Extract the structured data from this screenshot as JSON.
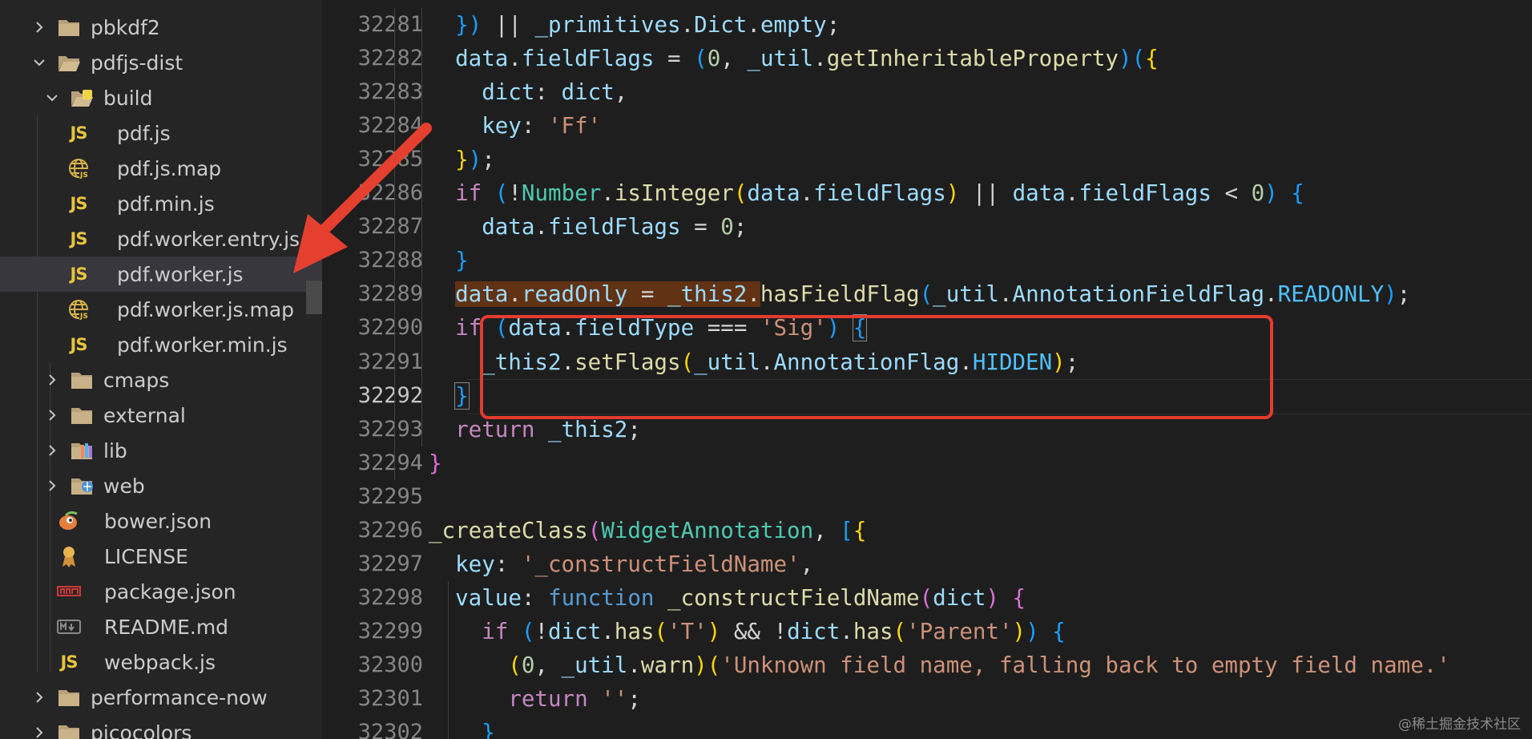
{
  "explorer": {
    "items": [
      {
        "label": "pbkdf2",
        "kind": "folder",
        "expanded": false,
        "indent": 0,
        "icon": "folder-icon"
      },
      {
        "label": "pdfjs-dist",
        "kind": "folder",
        "expanded": true,
        "indent": 0,
        "icon": "folder-open-icon"
      },
      {
        "label": "build",
        "kind": "folder",
        "expanded": true,
        "indent": 1,
        "icon": "folder-build-icon"
      },
      {
        "label": "pdf.js",
        "kind": "file",
        "indent": 2,
        "icon": "js-icon"
      },
      {
        "label": "pdf.js.map",
        "kind": "file",
        "indent": 2,
        "icon": "globe-map-icon"
      },
      {
        "label": "pdf.min.js",
        "kind": "file",
        "indent": 2,
        "icon": "js-icon"
      },
      {
        "label": "pdf.worker.entry.js",
        "kind": "file",
        "indent": 2,
        "icon": "js-icon"
      },
      {
        "label": "pdf.worker.js",
        "kind": "file",
        "indent": 2,
        "icon": "js-icon",
        "selected": true
      },
      {
        "label": "pdf.worker.js.map",
        "kind": "file",
        "indent": 2,
        "icon": "globe-map-icon"
      },
      {
        "label": "pdf.worker.min.js",
        "kind": "file",
        "indent": 2,
        "icon": "js-icon"
      },
      {
        "label": "cmaps",
        "kind": "folder",
        "expanded": false,
        "indent": 1,
        "icon": "folder-icon"
      },
      {
        "label": "external",
        "kind": "folder",
        "expanded": false,
        "indent": 1,
        "icon": "folder-icon"
      },
      {
        "label": "lib",
        "kind": "folder",
        "expanded": false,
        "indent": 1,
        "icon": "folder-lib-icon"
      },
      {
        "label": "web",
        "kind": "folder",
        "expanded": false,
        "indent": 1,
        "icon": "folder-web-icon"
      },
      {
        "label": "bower.json",
        "kind": "file",
        "indent": 1,
        "icon": "bower-icon"
      },
      {
        "label": "LICENSE",
        "kind": "file",
        "indent": 1,
        "icon": "license-icon"
      },
      {
        "label": "package.json",
        "kind": "file",
        "indent": 1,
        "icon": "npm-icon"
      },
      {
        "label": "README.md",
        "kind": "file",
        "indent": 1,
        "icon": "markdown-icon"
      },
      {
        "label": "webpack.js",
        "kind": "file",
        "indent": 1,
        "icon": "js-icon"
      },
      {
        "label": "performance-now",
        "kind": "folder",
        "expanded": false,
        "indent": 0,
        "icon": "folder-icon"
      },
      {
        "label": "picocolors",
        "kind": "folder",
        "expanded": false,
        "indent": 0,
        "icon": "folder-icon"
      }
    ],
    "js_badge": "JS"
  },
  "editor": {
    "active_line": "32292",
    "lines": [
      {
        "num": "32281",
        "indent": 2,
        "tokens": [
          [
            "b3",
            "})"
          ],
          [
            "p",
            " || "
          ],
          [
            "v",
            "_primitives"
          ],
          [
            "p",
            "."
          ],
          [
            "v",
            "Dict"
          ],
          [
            "p",
            "."
          ],
          [
            "v",
            "empty"
          ],
          [
            "p",
            ";"
          ]
        ]
      },
      {
        "num": "32282",
        "indent": 2,
        "tokens": [
          [
            "v",
            "data"
          ],
          [
            "p",
            "."
          ],
          [
            "v",
            "fieldFlags"
          ],
          [
            "p",
            " = "
          ],
          [
            "b3",
            "("
          ],
          [
            "n",
            "0"
          ],
          [
            "p",
            ", "
          ],
          [
            "v",
            "_util"
          ],
          [
            "p",
            "."
          ],
          [
            "f",
            "getInheritableProperty"
          ],
          [
            "b3",
            ")"
          ],
          [
            "b3",
            "("
          ],
          [
            "b1",
            "{"
          ]
        ]
      },
      {
        "num": "32283",
        "indent": 3,
        "tokens": [
          [
            "v",
            "dict"
          ],
          [
            "p",
            ": "
          ],
          [
            "v",
            "dict"
          ],
          [
            "p",
            ","
          ]
        ]
      },
      {
        "num": "32284",
        "indent": 3,
        "tokens": [
          [
            "v",
            "key"
          ],
          [
            "p",
            ": "
          ],
          [
            "s",
            "'Ff'"
          ]
        ]
      },
      {
        "num": "32285",
        "indent": 2,
        "tokens": [
          [
            "b1",
            "}"
          ],
          [
            "b3",
            ")"
          ],
          [
            "p",
            ";"
          ]
        ]
      },
      {
        "num": "32286",
        "indent": 2,
        "tokens": [
          [
            "k",
            "if"
          ],
          [
            "p",
            " "
          ],
          [
            "b3",
            "("
          ],
          [
            "p",
            "!"
          ],
          [
            "c",
            "Number"
          ],
          [
            "p",
            "."
          ],
          [
            "f",
            "isInteger"
          ],
          [
            "b1",
            "("
          ],
          [
            "v",
            "data"
          ],
          [
            "p",
            "."
          ],
          [
            "v",
            "fieldFlags"
          ],
          [
            "b1",
            ")"
          ],
          [
            "p",
            " || "
          ],
          [
            "v",
            "data"
          ],
          [
            "p",
            "."
          ],
          [
            "v",
            "fieldFlags"
          ],
          [
            "p",
            " < "
          ],
          [
            "n",
            "0"
          ],
          [
            "b3",
            ")"
          ],
          [
            "p",
            " "
          ],
          [
            "b3",
            "{"
          ]
        ]
      },
      {
        "num": "32287",
        "indent": 3,
        "tokens": [
          [
            "v",
            "data"
          ],
          [
            "p",
            "."
          ],
          [
            "v",
            "fieldFlags"
          ],
          [
            "p",
            " = "
          ],
          [
            "n",
            "0"
          ],
          [
            "p",
            ";"
          ]
        ]
      },
      {
        "num": "32288",
        "indent": 2,
        "tokens": [
          [
            "b3",
            "}"
          ]
        ]
      },
      {
        "num": "32289",
        "indent": 2,
        "tokens": [
          [
            "vh",
            "data"
          ],
          [
            "ph",
            "."
          ],
          [
            "vh",
            "readOnly"
          ],
          [
            "ph",
            " = "
          ],
          [
            "vh",
            "_this2"
          ],
          [
            "ph",
            "."
          ],
          [
            "f",
            "hasFieldFlag"
          ],
          [
            "b3",
            "("
          ],
          [
            "v",
            "_util"
          ],
          [
            "p",
            "."
          ],
          [
            "v",
            "AnnotationFieldFlag"
          ],
          [
            "p",
            "."
          ],
          [
            "o",
            "READONLY"
          ],
          [
            "b3",
            ")"
          ],
          [
            "p",
            ";"
          ]
        ]
      },
      {
        "num": "32290",
        "indent": 2,
        "tokens": [
          [
            "k",
            "if"
          ],
          [
            "p",
            " "
          ],
          [
            "b3",
            "("
          ],
          [
            "v",
            "data"
          ],
          [
            "p",
            "."
          ],
          [
            "v",
            "fieldType"
          ],
          [
            "p",
            " === "
          ],
          [
            "s",
            "'Sig'"
          ],
          [
            "b3",
            ")"
          ],
          [
            "p",
            " "
          ],
          [
            "bx",
            "{"
          ]
        ]
      },
      {
        "num": "32291",
        "indent": 3,
        "tokens": [
          [
            "v",
            "_this2"
          ],
          [
            "p",
            "."
          ],
          [
            "f",
            "setFlags"
          ],
          [
            "b1",
            "("
          ],
          [
            "v",
            "_util"
          ],
          [
            "p",
            "."
          ],
          [
            "v",
            "AnnotationFlag"
          ],
          [
            "p",
            "."
          ],
          [
            "o",
            "HIDDEN"
          ],
          [
            "b1",
            ")"
          ],
          [
            "p",
            ";"
          ]
        ]
      },
      {
        "num": "32292",
        "indent": 2,
        "tokens": [
          [
            "bx",
            "}"
          ]
        ]
      },
      {
        "num": "32293",
        "indent": 2,
        "tokens": [
          [
            "k",
            "return"
          ],
          [
            "p",
            " "
          ],
          [
            "v",
            "_this2"
          ],
          [
            "p",
            ";"
          ]
        ]
      },
      {
        "num": "32294",
        "indent": 1,
        "tokens": [
          [
            "b2",
            "}"
          ]
        ]
      },
      {
        "num": "32295",
        "indent": 0,
        "tokens": []
      },
      {
        "num": "32296",
        "indent": 1,
        "tokens": [
          [
            "f",
            "_createClass"
          ],
          [
            "b2",
            "("
          ],
          [
            "c",
            "WidgetAnnotation"
          ],
          [
            "p",
            ", "
          ],
          [
            "b3",
            "["
          ],
          [
            "b1",
            "{"
          ]
        ]
      },
      {
        "num": "32297",
        "indent": 2,
        "tokens": [
          [
            "v",
            "key"
          ],
          [
            "p",
            ": "
          ],
          [
            "s",
            "'_constructFieldName'"
          ],
          [
            "p",
            ","
          ]
        ]
      },
      {
        "num": "32298",
        "indent": 2,
        "tokens": [
          [
            "v",
            "value"
          ],
          [
            "p",
            ": "
          ],
          [
            "k2",
            "function"
          ],
          [
            "p",
            " "
          ],
          [
            "f",
            "_constructFieldName"
          ],
          [
            "b2",
            "("
          ],
          [
            "v",
            "dict"
          ],
          [
            "b2",
            ")"
          ],
          [
            "p",
            " "
          ],
          [
            "b2",
            "{"
          ]
        ]
      },
      {
        "num": "32299",
        "indent": 3,
        "tokens": [
          [
            "k",
            "if"
          ],
          [
            "p",
            " "
          ],
          [
            "b3",
            "("
          ],
          [
            "p",
            "!"
          ],
          [
            "v",
            "dict"
          ],
          [
            "p",
            "."
          ],
          [
            "f",
            "has"
          ],
          [
            "b1",
            "("
          ],
          [
            "s",
            "'T'"
          ],
          [
            "b1",
            ")"
          ],
          [
            "p",
            " && !"
          ],
          [
            "v",
            "dict"
          ],
          [
            "p",
            "."
          ],
          [
            "f",
            "has"
          ],
          [
            "b1",
            "("
          ],
          [
            "s",
            "'Parent'"
          ],
          [
            "b1",
            ")"
          ],
          [
            "b3",
            ")"
          ],
          [
            "p",
            " "
          ],
          [
            "b3",
            "{"
          ]
        ]
      },
      {
        "num": "32300",
        "indent": 4,
        "tokens": [
          [
            "b1",
            "("
          ],
          [
            "n",
            "0"
          ],
          [
            "p",
            ", "
          ],
          [
            "v",
            "_util"
          ],
          [
            "p",
            "."
          ],
          [
            "f",
            "warn"
          ],
          [
            "b1",
            ")"
          ],
          [
            "b1",
            "("
          ],
          [
            "s",
            "'Unknown field name, falling back to empty field name.'"
          ]
        ]
      },
      {
        "num": "32301",
        "indent": 4,
        "tokens": [
          [
            "k",
            "return"
          ],
          [
            "p",
            " "
          ],
          [
            "s",
            "''"
          ],
          [
            "p",
            ";"
          ]
        ]
      },
      {
        "num": "32302",
        "indent": 3,
        "tokens": [
          [
            "b3",
            "}"
          ]
        ]
      }
    ]
  },
  "watermark": "@稀土掘金技术社区",
  "colors": {
    "annotation": "#e33b2e",
    "selection": "#37373d",
    "highlight": "#613214"
  }
}
